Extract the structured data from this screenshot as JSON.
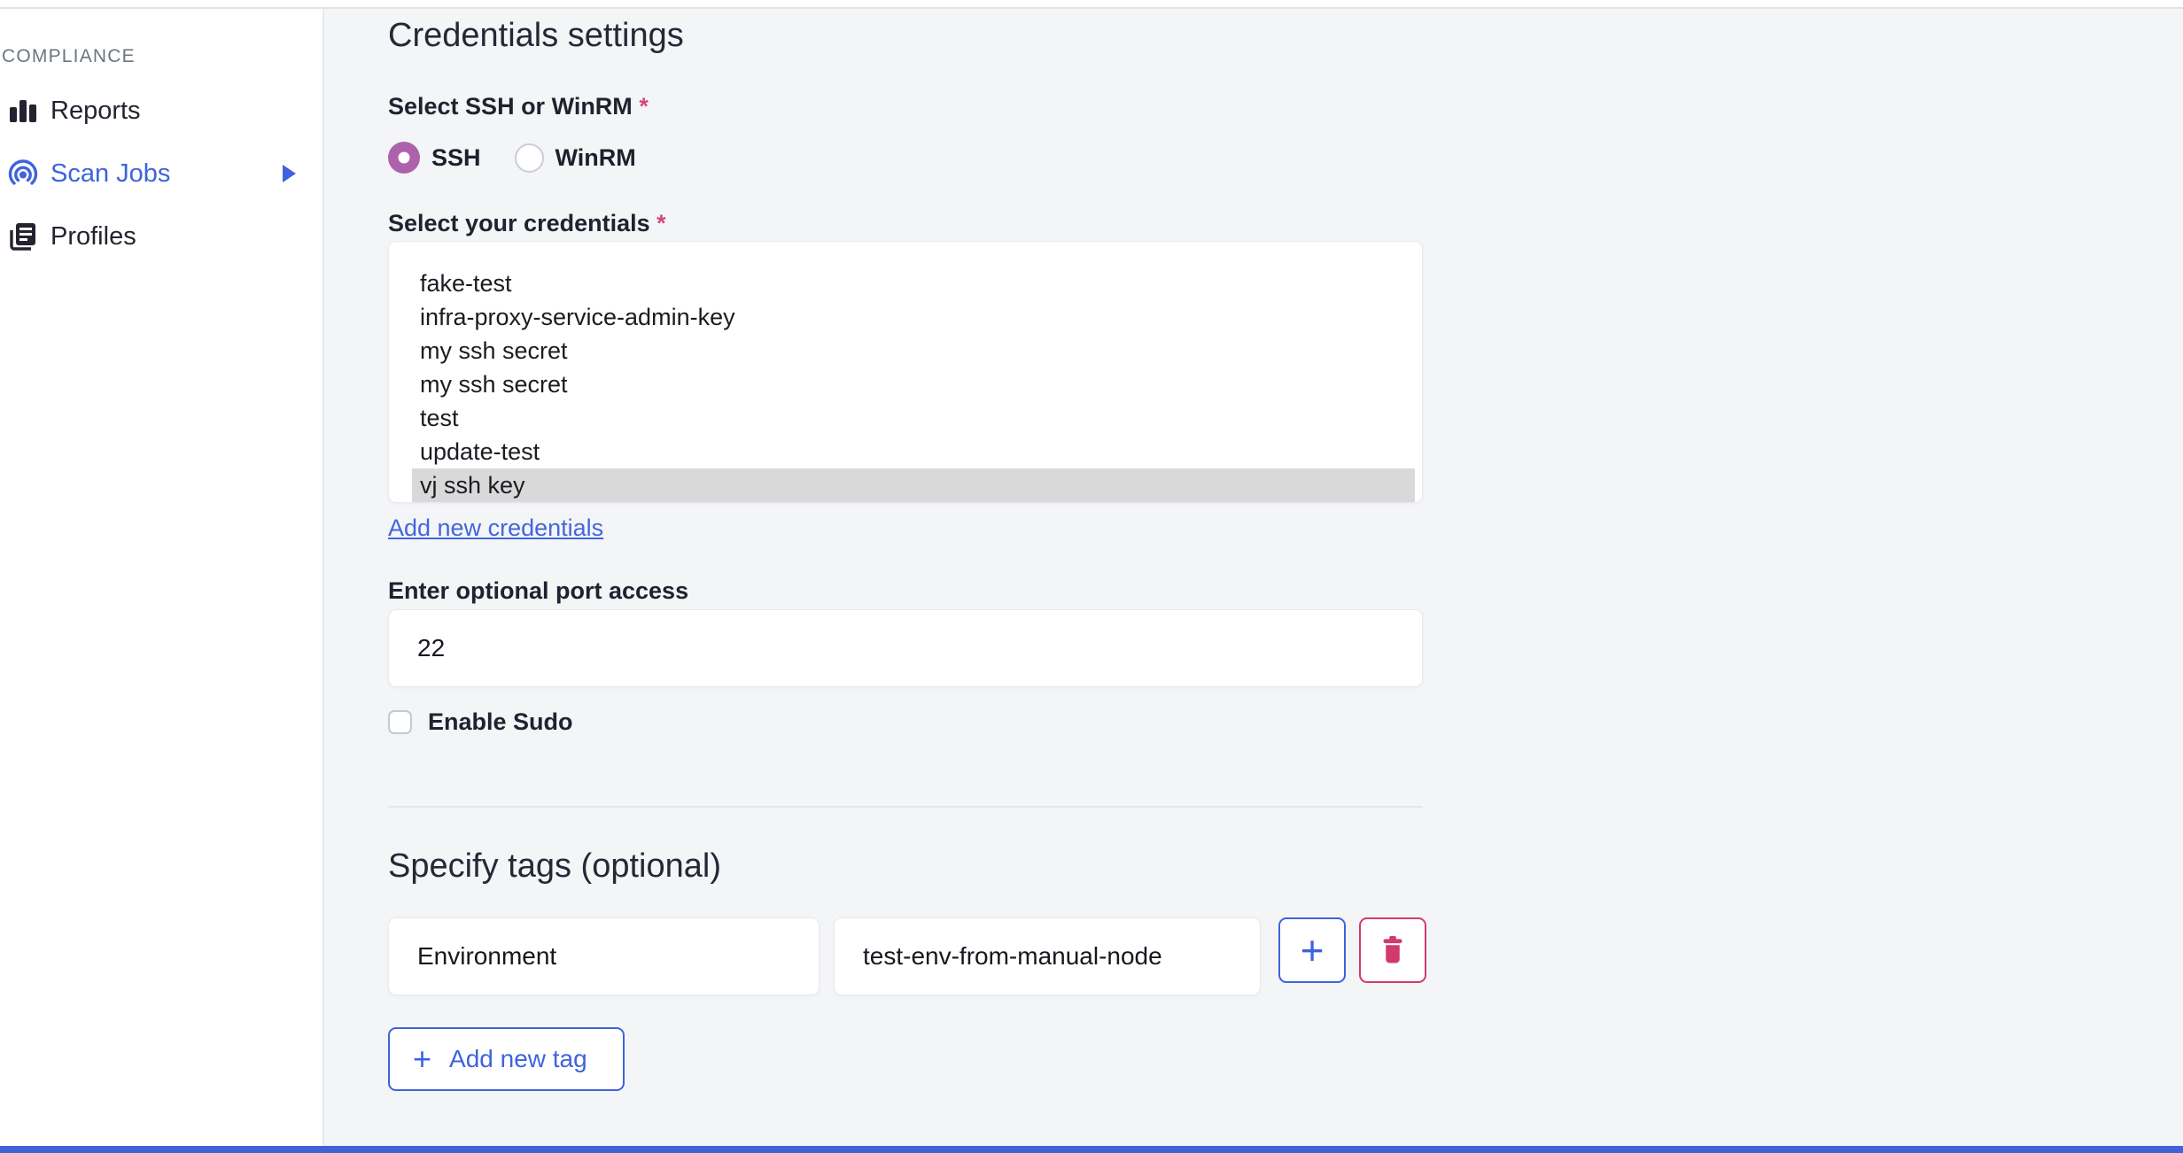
{
  "colors": {
    "accent_blue": "#3e63dc",
    "radio_selected_purple": "#ad62ac",
    "danger_pink": "#d23a6e",
    "required_marker_pink": "#d6477e",
    "selected_row_gray": "#d9d9d9",
    "main_background": "#f4f5f7",
    "bottom_bar_blue": "#3f62d8",
    "text_dark": "#262838"
  },
  "sidebar": {
    "section_label": "COMPLIANCE",
    "items": [
      {
        "label": "Reports",
        "icon": "bar-chart-icon",
        "active": false,
        "has_submenu": false
      },
      {
        "label": "Scan Jobs",
        "icon": "radar-icon",
        "active": true,
        "has_submenu": true
      },
      {
        "label": "Profiles",
        "icon": "library-icon",
        "active": false,
        "has_submenu": false
      }
    ]
  },
  "main": {
    "title": "Credentials settings",
    "protocol_field": {
      "label": "Select SSH or WinRM",
      "required_marker": "*",
      "options": [
        {
          "label": "SSH",
          "selected": true
        },
        {
          "label": "WinRM",
          "selected": false
        }
      ]
    },
    "credentials_field": {
      "label": "Select your credentials",
      "required_marker": "*",
      "options": [
        "fake-test",
        "infra-proxy-service-admin-key",
        "my ssh secret",
        "my ssh secret",
        "test",
        "update-test",
        "vj ssh key"
      ],
      "selected_option": "vj ssh key",
      "add_link_label": "Add new credentials"
    },
    "port_field": {
      "label": "Enter optional port access",
      "value": "22"
    },
    "sudo_field": {
      "label": "Enable Sudo",
      "checked": false
    },
    "tags": {
      "heading": "Specify tags (optional)",
      "rows": [
        {
          "key": "Environment",
          "value": "test-env-from-manual-node"
        }
      ],
      "plus_button_glyph": "+",
      "add_button": {
        "plus": "+",
        "label": "Add new tag"
      }
    }
  }
}
